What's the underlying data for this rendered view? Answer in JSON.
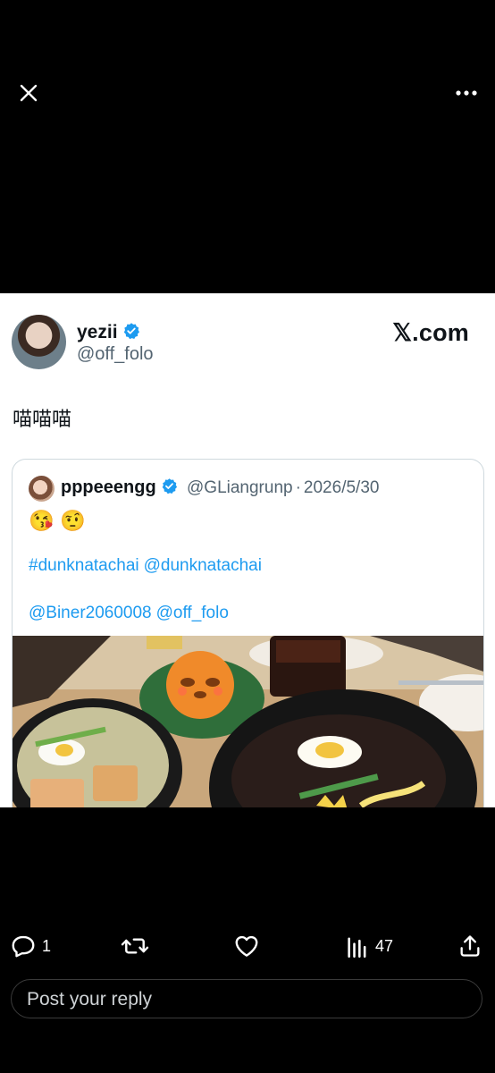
{
  "header": {
    "close_icon": "close-icon",
    "more_icon": "more-icon"
  },
  "tweet": {
    "author_name": "yezii",
    "author_handle": "@off_folo",
    "brand": "𝕏.com",
    "text": "喵喵喵"
  },
  "quote": {
    "author_name": "pppeeengg",
    "author_handle": "@GLiangrunp",
    "separator": "·",
    "date": "2026/5/30",
    "emojis": "😘 🤨",
    "line1": [
      "#dunknatachai",
      "@dunknatachai"
    ],
    "line2": [
      "@Biner2060008",
      "@off_folo"
    ]
  },
  "actions": {
    "reply_count": "1",
    "views_count": "47"
  },
  "reply": {
    "placeholder": "Post your reply"
  },
  "colors": {
    "accent": "#1d9bf0",
    "background": "#000000",
    "card": "#ffffff",
    "text_secondary": "#536471"
  }
}
